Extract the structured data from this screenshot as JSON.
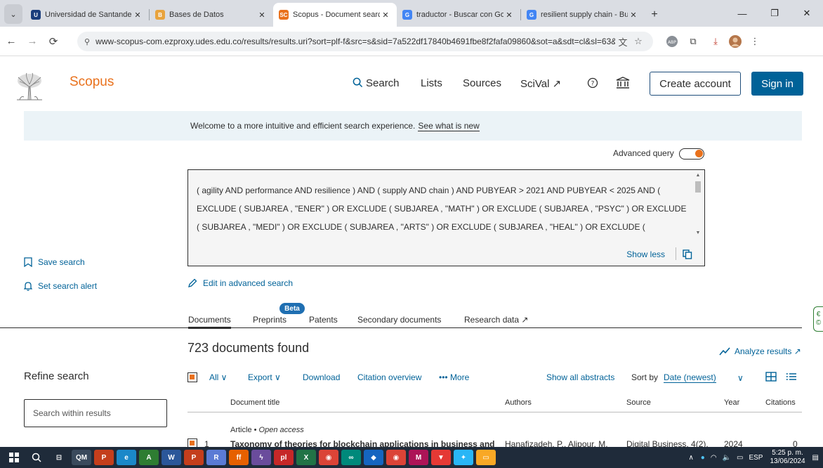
{
  "browser": {
    "tabs": [
      {
        "label": "Universidad de Santander - ",
        "favicon_color": "#1a3d7c",
        "favicon_glyph": "U",
        "active": false
      },
      {
        "label": "Bases de Datos",
        "favicon_color": "#e8a33d",
        "favicon_glyph": "B",
        "active": false
      },
      {
        "label": "Scopus - Document search",
        "favicon_color": "#e9711c",
        "favicon_glyph": "SC",
        "active": true
      },
      {
        "label": "traductor - Buscar con Goog",
        "favicon_color": "#4285f4",
        "favicon_glyph": "G",
        "active": false
      },
      {
        "label": "resilient supply chain - Busc",
        "favicon_color": "#4285f4",
        "favicon_glyph": "G",
        "active": false
      }
    ],
    "new_tab": "+",
    "minimize": "—",
    "restore": "❐",
    "close": "✕",
    "url": "www-scopus-com.ezproxy.udes.edu.co/results/results.uri?sort=plf-f&src=s&sid=7a522df17840b4691fbe8f2fafa09860&sot=a&sdt=cl&sl=63&s=%2..."
  },
  "header": {
    "brand": "Scopus",
    "nav": {
      "search": "Search",
      "lists": "Lists",
      "sources": "Sources",
      "scival": "SciVal ↗"
    },
    "create_account": "Create account",
    "sign_in": "Sign in"
  },
  "welcome": {
    "text": "Welcome to a more intuitive and efficient search experience.",
    "link": "See what is new"
  },
  "advanced_query": {
    "label": "Advanced query",
    "enabled": true
  },
  "query": {
    "line1": "( agility AND performance AND resilience ) AND ( supply AND chain ) AND PUBYEAR > 2021 AND PUBYEAR < 2025 AND (",
    "line2": "EXCLUDE ( SUBJAREA , \"ENER\" ) OR EXCLUDE ( SUBJAREA , \"MATH\" ) OR EXCLUDE ( SUBJAREA , \"PSYC\" ) OR EXCLUDE",
    "line3": "( SUBJAREA , \"MEDI\" ) OR EXCLUDE ( SUBJAREA , \"ARTS\" ) OR EXCLUDE ( SUBJAREA , \"HEAL\" ) OR EXCLUDE (",
    "show_less": "Show less"
  },
  "sidebar": {
    "save_search": "Save search",
    "set_alert": "Set search alert",
    "refine_title": "Refine search",
    "search_within_placeholder": "Search within results"
  },
  "edit_advanced": "Edit in advanced search",
  "doc_tabs": [
    {
      "label": "Documents",
      "active": true
    },
    {
      "label": "Preprints",
      "active": false
    },
    {
      "label": "Patents",
      "active": false
    },
    {
      "label": "Secondary documents",
      "active": false
    },
    {
      "label": "Research data ↗",
      "active": false
    }
  ],
  "beta_badge": "Beta",
  "results": {
    "count_text": "723 documents found",
    "analyze": "Analyze results ↗",
    "actions": {
      "all": "All ∨",
      "export": "Export ∨",
      "download": "Download",
      "citation_overview": "Citation overview",
      "more": "••• More",
      "show_abstracts": "Show all abstracts"
    },
    "sort_label": "Sort by",
    "sort_value": "Date (newest)",
    "columns": {
      "title": "Document title",
      "authors": "Authors",
      "source": "Source",
      "year": "Year",
      "citations": "Citations"
    },
    "rows": [
      {
        "type": "Article",
        "access": "Open access",
        "number": "1",
        "title": "Taxonomy of theories for blockchain applications in business and",
        "authors": "Hanafizadeh, P., Alipour, M.",
        "source": "Digital Business, 4(2),",
        "year": "2024",
        "citations": "0"
      }
    ]
  },
  "taskbar": {
    "apps": [
      {
        "name": "pom-qm",
        "glyph": "QM",
        "color": "#3a4a5c"
      },
      {
        "name": "powerpoint",
        "glyph": "P",
        "color": "#c43e1c"
      },
      {
        "name": "edge",
        "glyph": "e",
        "color": "#1b88c9"
      },
      {
        "name": "app-green",
        "glyph": "A",
        "color": "#2e7d32"
      },
      {
        "name": "word",
        "glyph": "W",
        "color": "#2b579a"
      },
      {
        "name": "powerpoint-2",
        "glyph": "P",
        "color": "#c43e1c"
      },
      {
        "name": "r-app",
        "glyph": "R",
        "color": "#5b7bd5"
      },
      {
        "name": "firefox",
        "glyph": "ff",
        "color": "#e66000"
      },
      {
        "name": "app-purple",
        "glyph": "ϟ",
        "color": "#6a4c9c"
      },
      {
        "name": "app-red",
        "glyph": "pl",
        "color": "#c62828"
      },
      {
        "name": "excel",
        "glyph": "X",
        "color": "#217346"
      },
      {
        "name": "chrome",
        "glyph": "◉",
        "color": "#db4437"
      },
      {
        "name": "app-teal",
        "glyph": "∞",
        "color": "#00897b"
      },
      {
        "name": "app-blue",
        "glyph": "◆",
        "color": "#1565c0"
      },
      {
        "name": "chrome-2",
        "glyph": "◉",
        "color": "#db4437"
      },
      {
        "name": "app-pink",
        "glyph": "M",
        "color": "#ad1457"
      },
      {
        "name": "brave",
        "glyph": "▼",
        "color": "#e53935"
      },
      {
        "name": "app-sky",
        "glyph": "✦",
        "color": "#29b6f6"
      },
      {
        "name": "explorer",
        "glyph": "▭",
        "color": "#f9a825"
      }
    ],
    "lang": "ESP",
    "time": "5:25 p. m.",
    "date": "13/06/2024"
  }
}
